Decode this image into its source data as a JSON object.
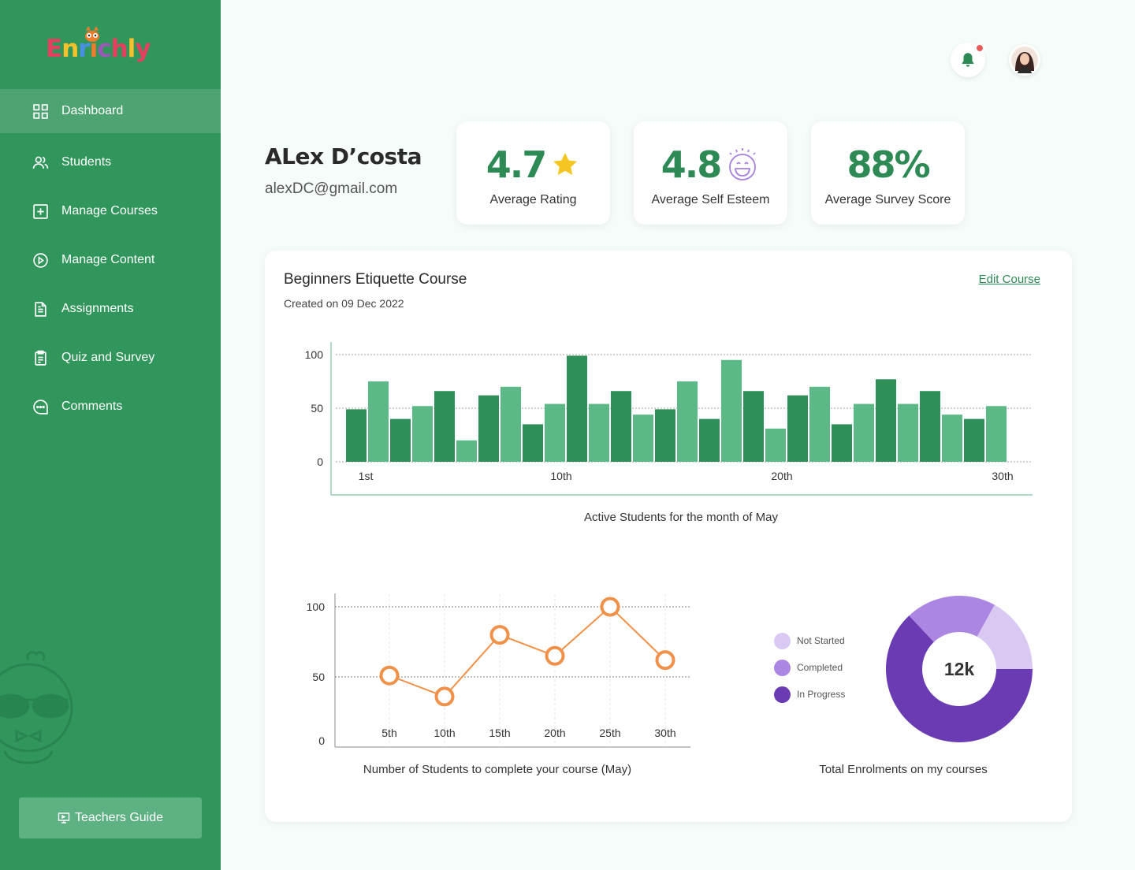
{
  "brand": {
    "name": "Enrichly"
  },
  "sidebar": {
    "items": [
      {
        "label": "Dashboard",
        "icon": "dashboard-icon",
        "active": true
      },
      {
        "label": "Students",
        "icon": "users-icon",
        "active": false
      },
      {
        "label": "Manage Courses",
        "icon": "plus-square-icon",
        "active": false
      },
      {
        "label": "Manage Content",
        "icon": "play-circle-icon",
        "active": false
      },
      {
        "label": "Assignments",
        "icon": "document-icon",
        "active": false
      },
      {
        "label": "Quiz and Survey",
        "icon": "clipboard-icon",
        "active": false
      },
      {
        "label": "Comments",
        "icon": "chat-icon",
        "active": false
      }
    ],
    "guide_label": "Teachers Guide"
  },
  "header": {
    "has_notification": true
  },
  "profile": {
    "name": "ALex D’costa",
    "email": "alexDC@gmail.com"
  },
  "stats": [
    {
      "value": "4.7",
      "label": "Average Rating",
      "icon": "star-icon"
    },
    {
      "value": "4.8",
      "label": "Average Self Esteem",
      "icon": "smile-icon"
    },
    {
      "value": "88%",
      "label": "Average Survey Score",
      "icon": ""
    }
  ],
  "course": {
    "title": "Beginners Etiquette Course",
    "created": "Created on 09 Dec 2022",
    "edit_label": "Edit Course"
  },
  "colors": {
    "primary": "#30965b",
    "bar_dark": "#2e8f58",
    "bar_light": "#5cb886",
    "line": "#f0914a",
    "not_started": "#d9c8f2",
    "completed": "#ab86e3",
    "in_progress": "#6a3bb2"
  },
  "chart_data": [
    {
      "type": "bar",
      "caption": "Active Students for the month of May",
      "x_tick_labels": [
        "1st",
        "10th",
        "20th",
        "30th"
      ],
      "ylim": [
        0,
        100
      ],
      "y_ticks": [
        0,
        50,
        100
      ],
      "values": [
        49,
        75,
        40,
        52,
        66,
        20,
        62,
        70,
        35,
        54,
        99,
        54,
        66,
        44,
        49,
        75,
        40,
        95,
        66,
        31,
        62,
        70,
        35,
        54,
        77,
        54,
        66,
        44,
        40,
        52
      ],
      "grid": true
    },
    {
      "type": "line",
      "caption": "Number of Students to complete your course (May)",
      "categories": [
        "5th",
        "10th",
        "15th",
        "20th",
        "25th",
        "30th"
      ],
      "values": [
        51,
        36,
        80,
        65,
        100,
        62
      ],
      "ylim": [
        0,
        100
      ],
      "y_ticks": [
        0,
        50,
        100
      ],
      "grid": true
    },
    {
      "type": "pie",
      "caption": "Total Enrolments on my courses",
      "center_label": "12k",
      "slices": [
        {
          "label": "Not Started",
          "value": 17
        },
        {
          "label": "Completed",
          "value": 20
        },
        {
          "label": "In Progress",
          "value": 63
        }
      ],
      "legend": "left"
    }
  ]
}
